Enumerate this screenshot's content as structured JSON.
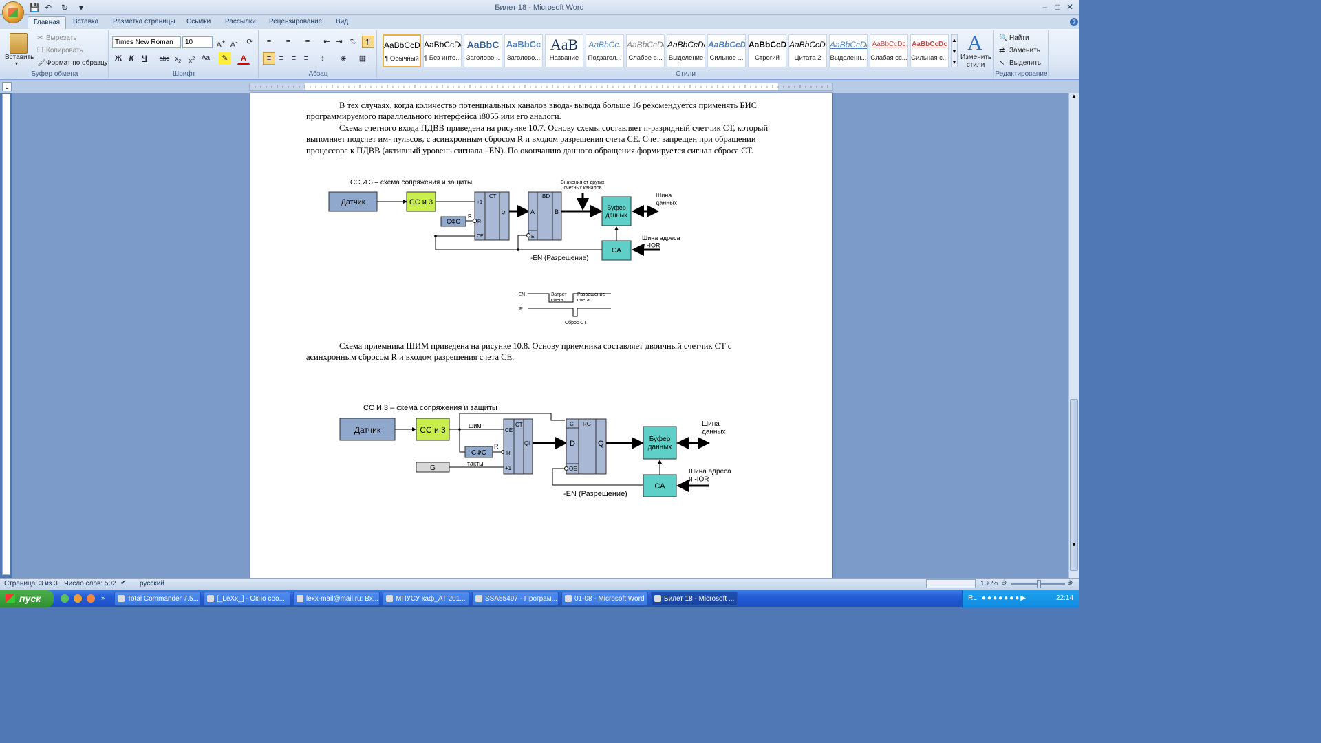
{
  "window": {
    "title": "Билет 18 - Microsoft Word"
  },
  "tabs": [
    "Главная",
    "Вставка",
    "Разметка страницы",
    "Ссылки",
    "Рассылки",
    "Рецензирование",
    "Вид"
  ],
  "ribbon": {
    "clipboard": {
      "label": "Буфер обмена",
      "paste": "Вставить",
      "cut": "Вырезать",
      "copy": "Копировать",
      "format_painter": "Формат по образцу"
    },
    "font": {
      "label": "Шрифт",
      "font_name": "Times New Roman",
      "font_size": "10"
    },
    "paragraph": {
      "label": "Абзац"
    },
    "styles": {
      "label": "Стили",
      "items": [
        {
          "preview": "AaBbCcDc",
          "name": "¶ Обычный"
        },
        {
          "preview": "AaBbCcDc",
          "name": "¶ Без инте..."
        },
        {
          "preview": "AaBbC",
          "name": "Заголово..."
        },
        {
          "preview": "AaBbCc",
          "name": "Заголово..."
        },
        {
          "preview": "AaB",
          "name": "Название"
        },
        {
          "preview": "AaBbCc.",
          "name": "Подзагол..."
        },
        {
          "preview": "AaBbCcDc",
          "name": "Слабое в..."
        },
        {
          "preview": "AaBbCcDc",
          "name": "Выделение"
        },
        {
          "preview": "AaBbCcDc",
          "name": "Сильное ..."
        },
        {
          "preview": "AaBbCcDc",
          "name": "Строгий"
        },
        {
          "preview": "AaBbCcDc",
          "name": "Цитата 2"
        },
        {
          "preview": "AaBbCcDc",
          "name": "Выделенн..."
        },
        {
          "preview": "AaBbCcDc",
          "name": "Слабая сс..."
        },
        {
          "preview": "AaBbCcDc",
          "name": "Сильная с..."
        }
      ],
      "change_styles": "Изменить стили"
    },
    "editing": {
      "label": "Редактирование",
      "find": "Найти",
      "replace": "Заменить",
      "select": "Выделить"
    }
  },
  "document": {
    "para1": "В тех случаях, когда количество потенциальных каналов ввода- вывода больше 16 рекомендуется применять БИС программируемого параллельного интерфейса i8055 или его аналоги.",
    "para2": "Схема счетного входа ПДВВ приведена на рисунке 10.7. Основу схемы составляет n-разрядный счетчик СТ, который выполняет подсчет им- пульсов, с асинхронным сбросом R и входом разрешения счета СЕ. Счет запрещен при обращении процессора к ПДВВ (активный уровень сигнала –EN). По окончанию данного обращения формируется сигнал сброса СТ.",
    "para3": "Схема приемника ШИМ приведена на рисунке 10.8. Основу приемника составляет двоичный счетчик СТ с асинхронным сбросом R и входом разрешения счета СЕ."
  },
  "diagram1": {
    "caption": "СС И 3 – схема сопряжения и защиты",
    "sensor": "Датчик",
    "ssz": "СС и 3",
    "sfs": "СФС",
    "r": "R",
    "ct": "СТ",
    "plus1": "+1",
    "ce": "CE",
    "qi": "Qi",
    "bd": "BD",
    "a": "A",
    "b": "B",
    "e": "E",
    "other": "Значения от других счетных каналов",
    "buffer": "Буфер данных",
    "data_bus": "Шина данных",
    "ca": "CA",
    "addr_bus": "Шина адреса и -IOR",
    "en": "-EN (Разрешение)"
  },
  "timing": {
    "en": "-EN",
    "r": "R",
    "forbid": "Запрет счета",
    "allow": "Разрешение счета",
    "reset": "Сброс СТ"
  },
  "diagram2": {
    "caption": "СС И 3 – схема сопряжения и защиты",
    "sensor": "Датчик",
    "ssz": "СС и 3",
    "shim": "шим",
    "sfs": "СФС",
    "r": "R",
    "g": "G",
    "clocks": "такты",
    "ct": "CT",
    "ce": "CE",
    "qi": "Qi",
    "plus1": "+1",
    "c": "C",
    "rg": "RG",
    "d": "D",
    "q": "Q",
    "oe": "OE",
    "buffer": "Буфер данных",
    "data_bus": "Шина данных",
    "ca": "CA",
    "addr_bus": "Шина адреса и -IOR",
    "en": "-EN (Разрешение)"
  },
  "status": {
    "page": "Страница: 3 из 3",
    "words": "Число слов: 502",
    "lang": "русский",
    "zoom": "130%"
  },
  "taskbar": {
    "start": "пуск",
    "items": [
      "Total Commander 7.5...",
      "[_LeXx_] - Окно соо...",
      "lexx-mail@mail.ru: Вх...",
      "МПУСУ каф_АТ 201...",
      "SSA55497 - Програм...",
      "01-08 - Microsoft Word",
      "Билет 18 - Microsoft ..."
    ],
    "lang": "RL",
    "clock": "22:14"
  },
  "colors": {
    "sensor": "#8fa8cc",
    "ssz": "#c8ef4e",
    "chip": "#a9b8d4",
    "buffer": "#5fd0c8"
  }
}
